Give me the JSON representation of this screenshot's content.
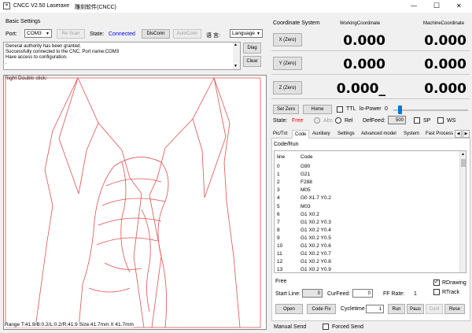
{
  "window": {
    "title": "CNCC V2.50  Laseraxe",
    "title_cjk": "雕刻软件(CNCC)",
    "min": "—",
    "max": "☐",
    "close": "✕"
  },
  "basic": {
    "group": "Basic Settings",
    "port_label": "Port:",
    "port_value": "COM3",
    "research_btn": "Re Scan",
    "state_label": "State:",
    "state_value": "Connected",
    "disconn_btn": "DisConn",
    "autoconn_btn": "AutoConn",
    "lang_label": "语 言:",
    "lang_value": "Language",
    "log": [
      "General authority has been granted.",
      "Successfully connected to the CNC, Port name:COM3",
      "Have access to configuration.",
      "."
    ],
    "diag_btn": "Diag",
    "clear_btn": "Clear"
  },
  "canvas": {
    "hint": "Right Double click:",
    "range": "Range T:41.9/B:0.2/L:0.2/R:41.9  Size:41.7mm X 41.7mm"
  },
  "coords": {
    "group": "Coordinate System",
    "working_label": "WorkingCoordinate",
    "machine_label": "MachineCoordinate",
    "rows": [
      {
        "btn": "X (Zero)",
        "working": "0.000",
        "machine": "0.000"
      },
      {
        "btn": "Y (Zero)",
        "working": "0.000",
        "machine": "0.000"
      },
      {
        "btn": "Z (Zero)",
        "working": "0.000_",
        "machine": "0.000"
      }
    ]
  },
  "controls": {
    "setzero_btn": "Set Zero",
    "home_btn": "Home",
    "ttl_label": "TTL",
    "lopower_label": "lo-Power",
    "lopower_value": "0",
    "state_label": "State:",
    "state_value": "Free",
    "abs_label": "Abs",
    "rel_label": "Rel",
    "deffeed_label": "DefFeed:",
    "deffeed_value": "500",
    "sp_label": "SP",
    "ws_label": "WS"
  },
  "tabs": [
    "Pic/Txt",
    "Code",
    "Auxiliary",
    "Settings",
    "Advanced model",
    "System",
    "Fast Process"
  ],
  "code": {
    "group": "Code/Run",
    "col_line": "line",
    "col_code": "Code",
    "rows": [
      [
        "0",
        "G90"
      ],
      [
        "1",
        "G21"
      ],
      [
        "2",
        "F288"
      ],
      [
        "3",
        "M05"
      ],
      [
        "4",
        "G0 X1.7 Y0.2"
      ],
      [
        "5",
        "M03"
      ],
      [
        "6",
        "G1 X0.2"
      ],
      [
        "7",
        "G1 X0.2 Y0.3"
      ],
      [
        "8",
        "G1 X0.2 Y0.4"
      ],
      [
        "9",
        "G1 X0.2 Y0.5"
      ],
      [
        "10",
        "G1 X0.2 Y0.6"
      ],
      [
        "11",
        "G1 X0.2 Y0.7"
      ],
      [
        "12",
        "G1 X0.2 Y0.8"
      ],
      [
        "13",
        "G1 X0.2 Y0.9"
      ]
    ]
  },
  "run": {
    "free_label": "Free",
    "rdrawing_label": "RDrawing",
    "rtrack_label": "RTrack",
    "startline_label": "Start Line:",
    "startline_value": "0",
    "curfeed_label": "CurFeed:",
    "curfeed_value": "0",
    "ffrate_label": "FF Rate:",
    "ffrate_value": "1",
    "open_btn": "Open",
    "codefix_btn": "Code Fix",
    "cycletime_label": "Cycletime",
    "cycletime_value": "1",
    "run_btn": "Run",
    "pause_btn": "Paus",
    "cont_btn": "Cont",
    "reset_btn": "Rese",
    "manual_label": "Manual Send",
    "forced_label": "Forced Send"
  },
  "colors": {
    "accent": "#0078d7",
    "connected": "#0000ff",
    "free": "#ff0000",
    "path": "#e05050"
  }
}
